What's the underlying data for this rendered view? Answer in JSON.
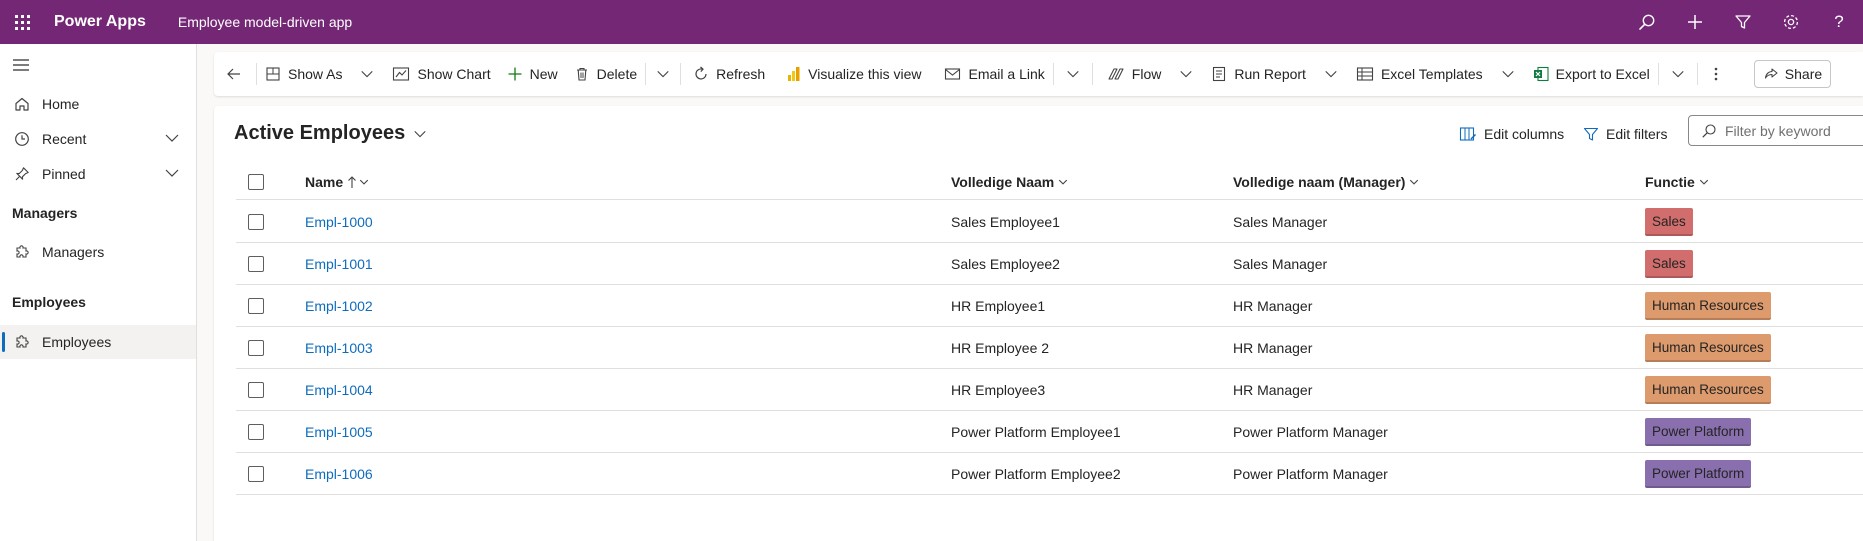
{
  "app": {
    "brand": "Power Apps",
    "name": "Employee model-driven app"
  },
  "topbar": {
    "icons": [
      "search-icon",
      "plus-icon",
      "filter-icon",
      "gear-icon",
      "help-icon"
    ],
    "help_label": "?"
  },
  "sidebar": {
    "items": [
      {
        "label": "Home",
        "icon": "home-icon"
      },
      {
        "label": "Recent",
        "icon": "clock-icon"
      },
      {
        "label": "Pinned",
        "icon": "pin-icon"
      }
    ],
    "groups": [
      {
        "title": "Managers",
        "items": [
          {
            "label": "Managers",
            "icon": "puzzle-icon"
          }
        ]
      },
      {
        "title": "Employees",
        "items": [
          {
            "label": "Employees",
            "icon": "puzzle-icon",
            "active": true
          }
        ]
      }
    ]
  },
  "commandbar": {
    "show_as": "Show As",
    "show_chart": "Show Chart",
    "new": "New",
    "delete": "Delete",
    "refresh": "Refresh",
    "visualize": "Visualize this view",
    "email_link": "Email a Link",
    "flow": "Flow",
    "run_report": "Run Report",
    "excel_templates": "Excel Templates",
    "export_excel": "Export to Excel",
    "share": "Share"
  },
  "view": {
    "title": "Active Employees",
    "edit_columns": "Edit columns",
    "edit_filters": "Edit filters",
    "filter_placeholder": "Filter by keyword"
  },
  "table": {
    "columns": [
      "Name",
      "Volledige Naam",
      "Volledige naam (Manager)",
      "Functie"
    ],
    "rows": [
      {
        "name": "Empl-1000",
        "full_name": "Sales Employee1",
        "manager": "Sales Manager",
        "function": "Sales",
        "color": "#d16d6d"
      },
      {
        "name": "Empl-1001",
        "full_name": "Sales Employee2",
        "manager": "Sales Manager",
        "function": "Sales",
        "color": "#d16d6d"
      },
      {
        "name": "Empl-1002",
        "full_name": "HR Employee1",
        "manager": "HR Manager",
        "function": "Human Resources",
        "color": "#dd9a6c"
      },
      {
        "name": "Empl-1003",
        "full_name": "HR Employee 2",
        "manager": "HR Manager",
        "function": "Human Resources",
        "color": "#dd9a6c"
      },
      {
        "name": "Empl-1004",
        "full_name": "HR Employee3",
        "manager": "HR Manager",
        "function": "Human Resources",
        "color": "#dd9a6c"
      },
      {
        "name": "Empl-1005",
        "full_name": "Power Platform Employee1",
        "manager": "Power Platform Manager",
        "function": "Power Platform",
        "color": "#8a6fae"
      },
      {
        "name": "Empl-1006",
        "full_name": "Power Platform Employee2",
        "manager": "Power Platform Manager",
        "function": "Power Platform",
        "color": "#8a6fae"
      }
    ]
  },
  "colors": {
    "header": "#742774",
    "link": "#0f6cbd",
    "accent": "#0f6cbd"
  }
}
